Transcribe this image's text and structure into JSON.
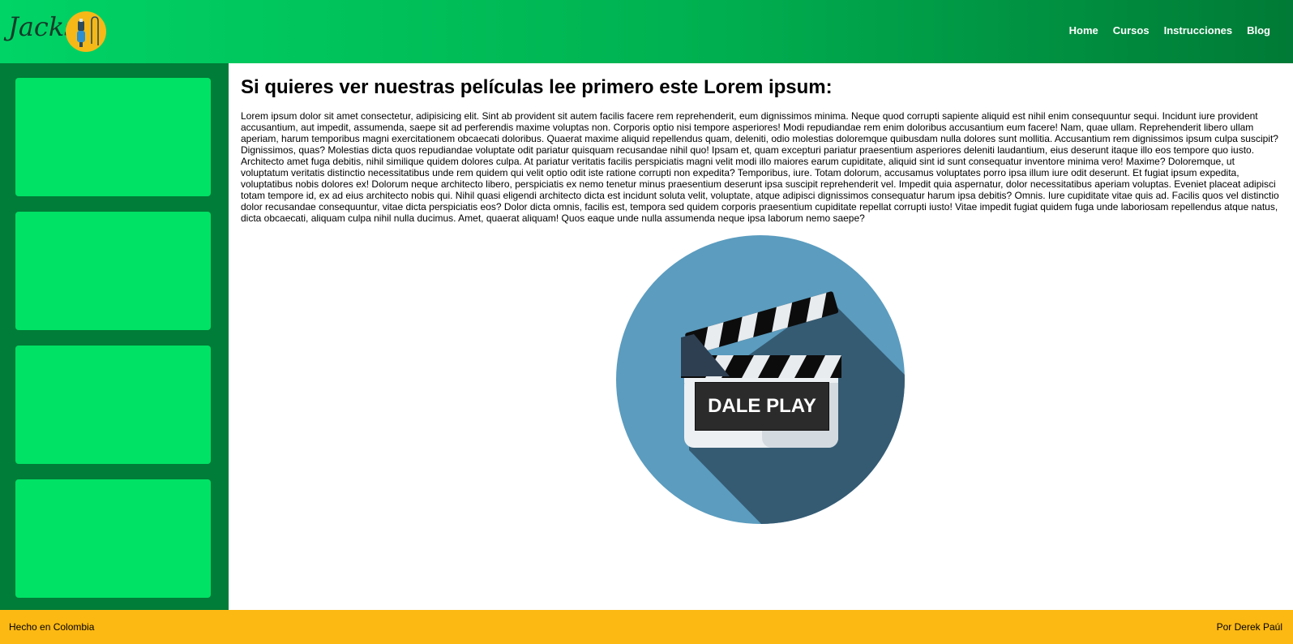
{
  "brand": {
    "logo_text": "Jacks",
    "logo_icon": "guitar-cable-icon"
  },
  "nav": {
    "items": [
      {
        "label": "Home"
      },
      {
        "label": "Cursos"
      },
      {
        "label": "Instrucciones"
      },
      {
        "label": "Blog"
      }
    ]
  },
  "sidebar": {
    "card_count": 4
  },
  "main": {
    "title": "Si quieres ver nuestras películas lee primero este Lorem ipsum:",
    "paragraph": "Lorem ipsum dolor sit amet consectetur, adipisicing elit. Sint ab provident sit autem facilis facere rem reprehenderit, eum dignissimos minima. Neque quod corrupti sapiente aliquid est nihil enim consequuntur sequi. Incidunt iure provident accusantium, aut impedit, assumenda, saepe sit ad perferendis maxime voluptas non. Corporis optio nisi tempore asperiores! Modi repudiandae rem enim doloribus accusantium eum facere! Nam, quae ullam. Reprehenderit libero ullam aperiam, harum temporibus magni exercitationem obcaecati doloribus. Quaerat maxime aliquid repellendus quam, deleniti, odio molestias doloremque quibusdam nulla dolores sunt mollitia. Accusantium rem dignissimos ipsum culpa suscipit? Dignissimos, quas? Molestias dicta quos repudiandae voluptate odit pariatur quisquam recusandae nihil quo! Ipsam et, quam excepturi pariatur praesentium asperiores deleniti laudantium, eius deserunt itaque illo eos tempore quo iusto. Architecto amet fuga debitis, nihil similique quidem dolores culpa. At pariatur veritatis facilis perspiciatis magni velit modi illo maiores earum cupiditate, aliquid sint id sunt consequatur inventore minima vero! Maxime? Doloremque, ut voluptatum veritatis distinctio necessitatibus unde rem quidem qui velit optio odit iste ratione corrupti non expedita? Temporibus, iure. Totam dolorum, accusamus voluptates porro ipsa illum iure odit deserunt. Et fugiat ipsum expedita, voluptatibus nobis dolores ex! Dolorum neque architecto libero, perspiciatis ex nemo tenetur minus praesentium deserunt ipsa suscipit reprehenderit vel. Impedit quia aspernatur, dolor necessitatibus aperiam voluptas. Eveniet placeat adipisci totam tempore id, ex ad eius architecto nobis qui. Nihil quasi eligendi architecto dicta est incidunt soluta velit, voluptate, atque adipisci dignissimos consequatur harum ipsa debitis? Omnis. Iure cupiditate vitae quis ad. Facilis quos vel distinctio dolor recusandae consequuntur, vitae dicta perspiciatis eos? Dolor dicta omnis, facilis est, tempora sed quidem corporis praesentium cupiditate repellat corrupti iusto! Vitae impedit fugiat quidem fuga unde laboriosam repellendus atque natus, dicta obcaecati, aliquam culpa nihil nulla ducimus. Amet, quaerat aliquam! Quos eaque unde nulla assumenda neque ipsa laborum nemo saepe?",
    "play_label": "DALE PLAY",
    "play_icon": "clapperboard-icon"
  },
  "footer": {
    "left": "Hecho en Colombia",
    "right": "Por Derek Paúl"
  },
  "colors": {
    "header_start": "#00d466",
    "header_end": "#007a36",
    "sidebar": "#007d38",
    "card": "#00e265",
    "footer": "#fdb913",
    "play_circle": "#5b9cbf",
    "play_shadow": "#355b73"
  }
}
